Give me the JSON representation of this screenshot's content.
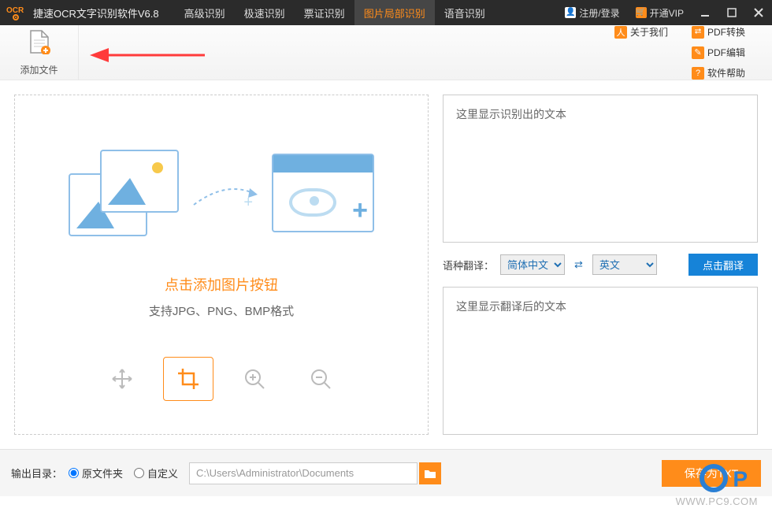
{
  "app": {
    "title": "捷速OCR文字识别软件V6.8"
  },
  "nav": {
    "items": [
      "高级识别",
      "极速识别",
      "票证识别",
      "图片局部识别",
      "语音识别"
    ],
    "active_index": 3
  },
  "titlebar_right": {
    "login": "注册/登录",
    "vip": "开通VIP"
  },
  "toolbar": {
    "add_file": "添加文件"
  },
  "links": {
    "about": "关于我们",
    "pdf_convert": "PDF转换",
    "pdf_edit": "PDF编辑",
    "help": "软件帮助"
  },
  "main": {
    "prompt_title": "点击添加图片按钮",
    "prompt_sub": "支持JPG、PNG、BMP格式",
    "tools": [
      "move",
      "crop",
      "zoom-in",
      "zoom-out"
    ],
    "tools_active_index": 1,
    "ocr_placeholder": "这里显示识别出的文本",
    "translate_label": "语种翻译：",
    "lang_from_options": [
      "简体中文"
    ],
    "lang_from_value": "简体中文",
    "lang_to_options": [
      "英文"
    ],
    "lang_to_value": "英文",
    "translate_btn": "点击翻译",
    "translated_placeholder": "这里显示翻译后的文本"
  },
  "bottom": {
    "output_label": "输出目录：",
    "radio_original": "原文件夹",
    "radio_custom": "自定义",
    "path_value": "C:\\Users\\Administrator\\Documents",
    "radio_selected": "original",
    "save_btn": "保存为TXT"
  },
  "watermark": {
    "brand": "P",
    "url": "WWW.PC9.COM"
  }
}
